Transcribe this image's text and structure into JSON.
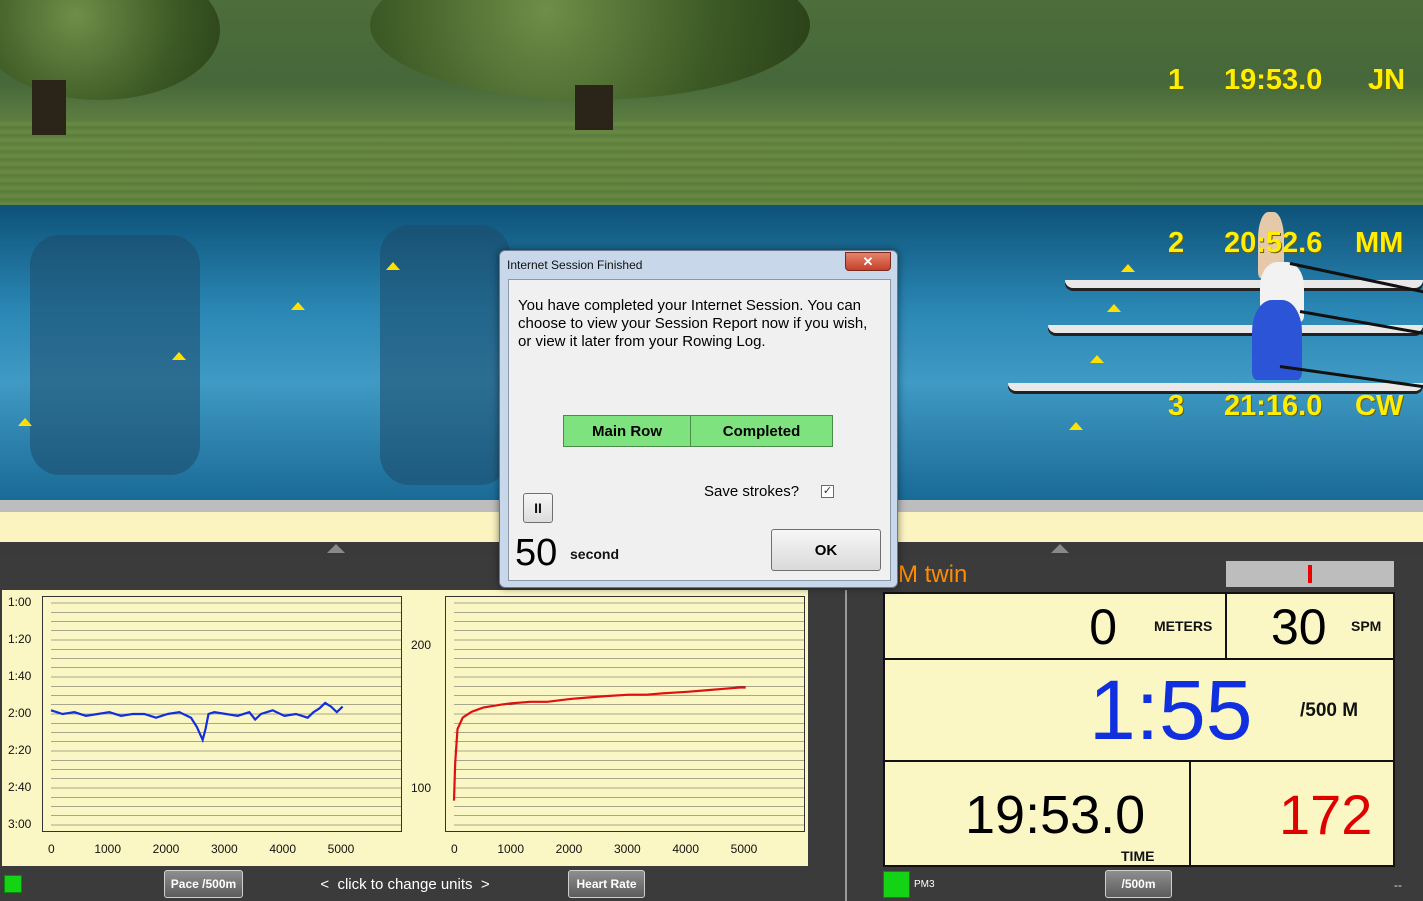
{
  "standings": [
    {
      "place": "1",
      "time": "19:53.0",
      "initials": "JN"
    },
    {
      "place": "2",
      "time": "20:52.6",
      "initials": "MM"
    },
    {
      "place": "3",
      "time": "21:16.0",
      "initials": "CW"
    }
  ],
  "dialog": {
    "title": "Internet Session Finished",
    "close_glyph": "✕",
    "message": "You have completed your Internet Session. You can choose to view your Session Report now if you wish, or view it later from your Rowing Log.",
    "status_label": "Main Row",
    "status_value": "Completed",
    "save_strokes_label": "Save strokes?",
    "save_strokes_checked": true,
    "pause_glyph": "II",
    "countdown_value": "50",
    "countdown_unit": "second",
    "ok_label": "OK"
  },
  "graphs": {
    "change_units_hint": "<  click to change units  >",
    "pace_button": "Pace /500m",
    "heart_rate_button": "Heart Rate"
  },
  "monitor": {
    "title": "M twin",
    "meters_value": "0",
    "meters_unit": "METERS",
    "spm_value": "30",
    "spm_unit": "SPM",
    "pace_value": "1:55",
    "pace_unit": "/500 M",
    "time_value": "19:53.0",
    "time_unit": "TIME",
    "heart_rate_value": "172",
    "pm_label": "PM3",
    "unit_button": "/500m",
    "corner_text": "--"
  },
  "colors": {
    "pace_line": "#1030e0",
    "heart_line": "#e01010",
    "pace_big": "#1030e0",
    "heart_big": "#e00000"
  },
  "chart_data": [
    {
      "type": "line",
      "series": [
        {
          "name": "Pace /500m",
          "x": [
            0,
            200,
            400,
            600,
            800,
            1000,
            1200,
            1400,
            1600,
            1800,
            2000,
            2200,
            2400,
            2500,
            2600,
            2650,
            2700,
            2800,
            3000,
            3200,
            3400,
            3500,
            3600,
            3800,
            4000,
            4200,
            4400,
            4500,
            4600,
            4700,
            4800,
            4900,
            5000
          ],
          "y": [
            118,
            120,
            119,
            121,
            120,
            119,
            121,
            120,
            120,
            122,
            120,
            119,
            122,
            127,
            134,
            128,
            120,
            119,
            120,
            121,
            119,
            123,
            120,
            118,
            121,
            120,
            122,
            119,
            117,
            114,
            116,
            119,
            116
          ]
        }
      ],
      "y_ticks": [
        "1:00",
        "1:20",
        "1:40",
        "2:00",
        "2:20",
        "2:40",
        "3:00"
      ],
      "ylim": [
        60,
        180
      ],
      "y_inverted": true,
      "x_ticks": [
        "0",
        "1000",
        "2000",
        "3000",
        "4000",
        "5000"
      ],
      "xlim": [
        0,
        6000
      ],
      "grid": true
    },
    {
      "type": "line",
      "series": [
        {
          "name": "Heart Rate",
          "x": [
            0,
            20,
            60,
            150,
            300,
            500,
            800,
            1000,
            1300,
            1600,
            2000,
            2300,
            2600,
            3000,
            3300,
            3600,
            4000,
            4300,
            4600,
            4900,
            5000
          ],
          "y": [
            92,
            118,
            142,
            150,
            154,
            157,
            159,
            160,
            161,
            161,
            163,
            164,
            165,
            166,
            166,
            167,
            168,
            169,
            170,
            171,
            171
          ]
        }
      ],
      "y_ticks": [
        "100",
        "200"
      ],
      "ylim": [
        75,
        230
      ],
      "x_ticks": [
        "0",
        "1000",
        "2000",
        "3000",
        "4000",
        "5000"
      ],
      "xlim": [
        0,
        6000
      ],
      "grid": true
    }
  ]
}
